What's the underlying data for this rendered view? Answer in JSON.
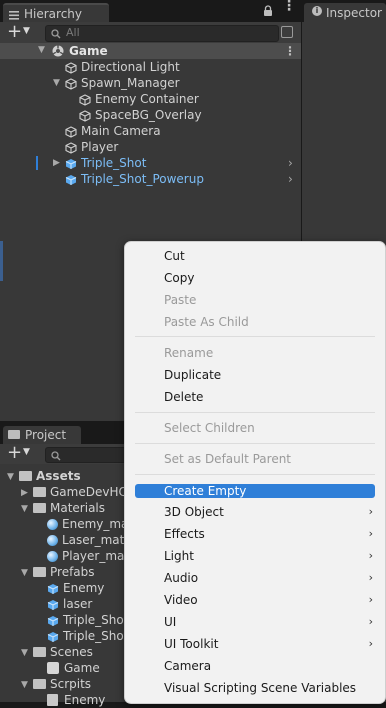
{
  "hierarchy": {
    "tab_title": "Hierarchy",
    "search_placeholder": "All",
    "scene": "Game",
    "items": [
      {
        "label": "Directional Light"
      },
      {
        "label": "Spawn_Manager"
      },
      {
        "label": "Enemy Container"
      },
      {
        "label": "SpaceBG_Overlay"
      },
      {
        "label": "Main Camera"
      },
      {
        "label": "Player"
      },
      {
        "label": "Triple_Shot"
      },
      {
        "label": "Triple_Shot_Powerup"
      }
    ]
  },
  "inspector": {
    "tab_title": "Inspector"
  },
  "project": {
    "tab_title": "Project",
    "items": [
      {
        "label": "Assets"
      },
      {
        "label": "GameDevHQ"
      },
      {
        "label": "Materials"
      },
      {
        "label": "Enemy_mat"
      },
      {
        "label": "Laser_mat"
      },
      {
        "label": "Player_mat"
      },
      {
        "label": "Prefabs"
      },
      {
        "label": "Enemy"
      },
      {
        "label": "laser"
      },
      {
        "label": "Triple_Shot"
      },
      {
        "label": "Triple_Shot"
      },
      {
        "label": "Scenes"
      },
      {
        "label": "Game"
      },
      {
        "label": "Scrpits"
      },
      {
        "label": "Enemy"
      }
    ]
  },
  "menu": {
    "items": [
      {
        "label": "Cut"
      },
      {
        "label": "Copy"
      },
      {
        "label": "Paste"
      },
      {
        "label": "Paste As Child"
      },
      {
        "label": "Rename"
      },
      {
        "label": "Duplicate"
      },
      {
        "label": "Delete"
      },
      {
        "label": "Select Children"
      },
      {
        "label": "Set as Default Parent"
      },
      {
        "label": "Create Empty"
      },
      {
        "label": "3D Object"
      },
      {
        "label": "Effects"
      },
      {
        "label": "Light"
      },
      {
        "label": "Audio"
      },
      {
        "label": "Video"
      },
      {
        "label": "UI"
      },
      {
        "label": "UI Toolkit"
      },
      {
        "label": "Camera"
      },
      {
        "label": "Visual Scripting Scene Variables"
      }
    ]
  },
  "colors": {
    "accent": "#2f7fd8",
    "prefab_text": "#7cbdf6"
  }
}
